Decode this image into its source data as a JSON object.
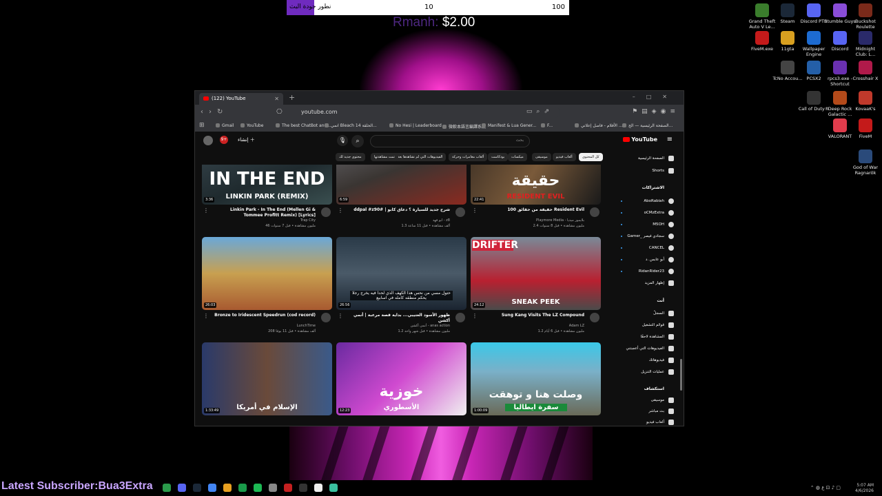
{
  "overlay": {
    "vote_label": "نطور جودة البث",
    "vote_left": "10",
    "vote_right": "100",
    "donor": "Rmanh:",
    "amount": "$2.00",
    "latest_subscriber": "Latest Subscriber:Bua3Extra"
  },
  "desktop_icons": [
    {
      "label": "Grand Theft Auto V Le..."
    },
    {
      "label": "Steam"
    },
    {
      "label": "Discord PTB"
    },
    {
      "label": "Stumble Guys"
    },
    {
      "label": "Buckshot Roulette"
    },
    {
      "label": "FiveM.exe"
    },
    {
      "label": "11gta"
    },
    {
      "label": "Wallpaper Engine"
    },
    {
      "label": "Discord"
    },
    {
      "label": "Midnight Club: L..."
    },
    {
      "label": "TcNo Accou..."
    },
    {
      "label": "PCSX2"
    },
    {
      "label": "rpcs3.exe - Shortcut"
    },
    {
      "label": "Crosshair X"
    },
    {
      "label": "Call of Duty®"
    },
    {
      "label": "Deep Rock Galactic ..."
    },
    {
      "label": "KovaaK's"
    },
    {
      "label": "VALORANT"
    },
    {
      "label": "FiveM"
    },
    {
      "label": "God of War Ragnarök"
    }
  ],
  "browser": {
    "tab_title": "(122) YouTube",
    "url": "youtube.com",
    "bookmarks": [
      "Gmail",
      "YouTube",
      "The best ChatBot and...",
      "انمي Bleach الحلقة 14...",
      "No Hesi | Leaderboard",
      "微軟本語言編譯系統",
      "Manifest & Lua Gener...",
      "F...",
      "الأفلام - فاصل إعلاني ...",
      "الصفحة الرئيسية — الح..."
    ]
  },
  "youtube": {
    "logo": "YouTube",
    "create": "إنشاء",
    "notif_count": "9+",
    "search_placeholder": "بحث",
    "chips": [
      "كل المحتوى",
      "ألعاب فيديو",
      "موسيقى",
      "ميكسات",
      "بودكاست",
      "ألعاب مغامرات وحركة",
      "الفيديوهات التي لم تشاهدها بعد",
      "تمت مشاهدتها",
      "محتوى جديد لك"
    ],
    "sidebar": {
      "home": "الصفحة الرئيسية",
      "shorts": "Shorts",
      "subs_header": "الاشتراكات",
      "subs": [
        "AboRabiah",
        "oCMzExtra",
        "M5OH",
        "Gamer_ سجادي فيصر",
        "CANCEL",
        "أبو عابس .د",
        "RidanRider23"
      ],
      "show_more": "إظهار المزيد",
      "you_header": "أنت",
      "you": [
        "السجلّ",
        "قوائم التشغيل",
        "المشاهدة لاحقًا",
        "الفيديوهات التي أعجبتني",
        "فيديوهاتك",
        "عمليات التنزيل"
      ],
      "explore_header": "استكشاف",
      "explore": [
        "موسيقى",
        "بث مباشر",
        "ألعاب فيديو"
      ]
    },
    "videos": [
      {
        "title": "Linkin Park - In The End (Mellen Gi & Tommee Profitt Remix) [Lyrics]",
        "channel": "Trap City",
        "meta": "46 مليون مشاهدة • قبل 7 سنوات",
        "duration": "3:36",
        "thumb_text": "IN THE END",
        "thumb_sub": "LINKIN PARK (REMIX)"
      },
      {
        "title": "ddpal #z90# | شرح جديد للسيارة ؟ دعاق كابو",
        "channel": "ابو فهد - z8",
        "meta": "1.3 ألف مشاهدة • قبل 11 ساعة",
        "duration": "6:59",
        "thumb_text": "",
        "thumb_sub": ""
      },
      {
        "title": "100 حقيقة من حقائق Resident Evil",
        "channel": "Playmore Media - بلايمور ميديا",
        "meta": "2.4 مليون مشاهدة • قبل 8 سنوات",
        "duration": "22:41",
        "thumb_text": "حقيقة",
        "thumb_sub": "RESIDENT EVIL"
      },
      {
        "title": "Bronze to Iridescent Speedrun (cod record)",
        "channel": "LunchTime",
        "meta": "208 ألف مشاهدة • قبل 11 يومًا",
        "duration": "26:03",
        "thumb_text": "",
        "thumb_sub": ""
      },
      {
        "title": "ظهور الأسود العتيبي... بداية قصة مرعبة | أنمي أكشن",
        "channel": "أنمي أكشن - anas action",
        "meta": "1.2 مليون مشاهدة • قبل شهر واحد",
        "duration": "26:56",
        "thumb_text": "",
        "thumb_sub": "",
        "caption": "حتول مسي من نحس هذا الكهف الذي لحدا فيه يخرج رجلا يحكم منطقه كامله في اسابيع"
      },
      {
        "title": "Sung Kang Visits The LZ Compound",
        "channel": "Adam LZ",
        "meta": "1.2 مليون مشاهدة • قبل 6 أيام",
        "duration": "24:12",
        "thumb_text": "DRIFTER",
        "thumb_sub": "SNEAK PEEK"
      },
      {
        "title": "",
        "channel": "",
        "meta": "",
        "duration": "1:33:49",
        "thumb_text": "",
        "thumb_sub": "الإسلام في أمريكا"
      },
      {
        "title": "",
        "channel": "",
        "meta": "",
        "duration": "12:23",
        "thumb_text": "خوزية",
        "thumb_sub": "الأسطوري"
      },
      {
        "title": "",
        "channel": "",
        "meta": "",
        "duration": "1:00:09",
        "thumb_text": "وصلت هنا و توهقت",
        "thumb_sub": "سفرة ايطاليا"
      }
    ]
  },
  "tray": {
    "lang": "ع",
    "time": "5:07 AM",
    "date": "4/6/2026"
  }
}
